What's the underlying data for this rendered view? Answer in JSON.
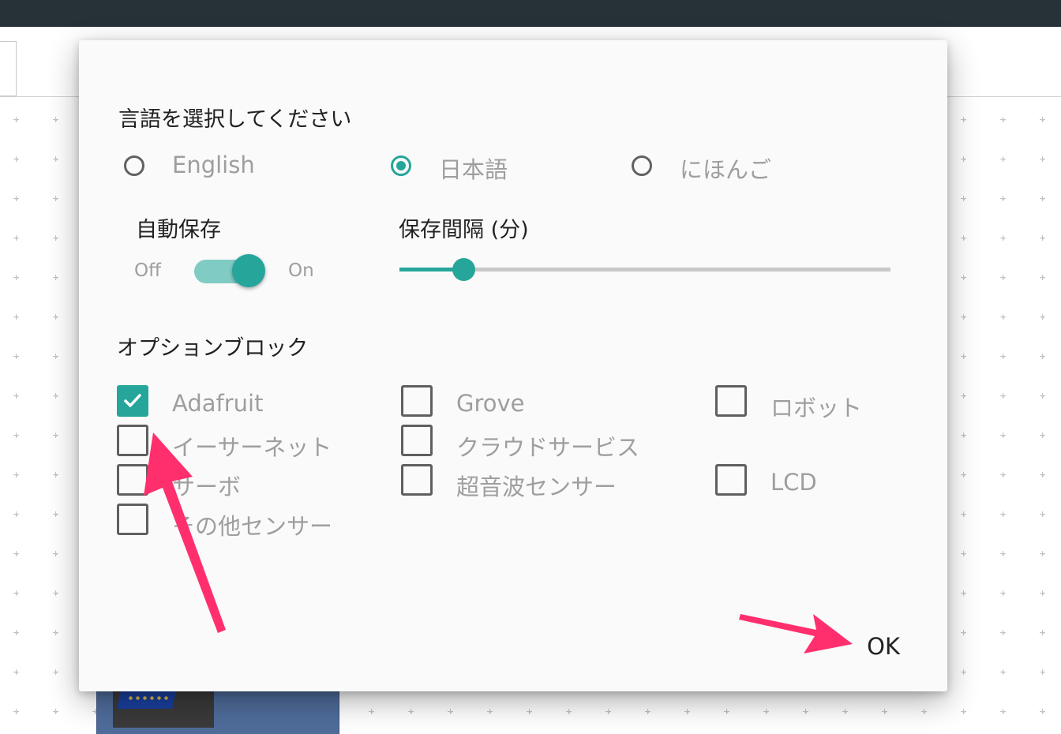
{
  "colors": {
    "accent": "#26a69a",
    "accent_light": "#80cbc4",
    "annotation_arrow": "#ff2f6e",
    "top_bar": "#263238"
  },
  "dialog": {
    "language_title": "言語を選択してください",
    "languages": [
      {
        "label": "English",
        "selected": false
      },
      {
        "label": "日本語",
        "selected": true
      },
      {
        "label": "にほんご",
        "selected": false
      }
    ],
    "autosave": {
      "title": "自動保存",
      "off_label": "Off",
      "on_label": "On",
      "enabled": true
    },
    "save_interval": {
      "title": "保存間隔 (分)",
      "level": 0.13
    },
    "option_blocks": {
      "title": "オプションブロック",
      "items": [
        {
          "label": "Adafruit",
          "checked": true
        },
        {
          "label": "Grove",
          "checked": false
        },
        {
          "label": "ロボット",
          "checked": false
        },
        {
          "label": "イーサーネット",
          "checked": false
        },
        {
          "label": "クラウドサービス",
          "checked": false
        },
        {
          "label": "サーボ",
          "checked": false
        },
        {
          "label": "超音波センサー",
          "checked": false
        },
        {
          "label": "LCD",
          "checked": false
        },
        {
          "label": "その他センサー",
          "checked": false
        }
      ]
    },
    "ok_label": "OK"
  }
}
